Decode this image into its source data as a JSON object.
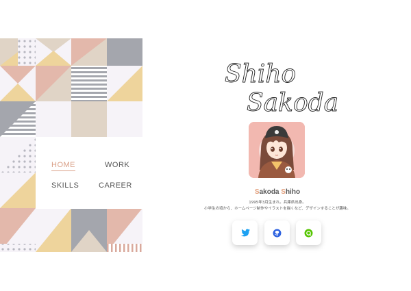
{
  "nav": {
    "items": [
      {
        "label": "HOME",
        "active": true
      },
      {
        "label": "WORK",
        "active": false
      },
      {
        "label": "SKILLS",
        "active": false
      },
      {
        "label": "CAREER",
        "active": false
      }
    ]
  },
  "profile": {
    "signature_line1": "Shiho",
    "signature_line2": "Sakoda",
    "name_initial_1": "S",
    "name_rest_1": "akoda ",
    "name_initial_2": "S",
    "name_rest_2": "hiho",
    "bio_line1": "1995年3月生まれ。兵庫県出身。",
    "bio_line2": "小学生の頃から、ホームページ制作やイラストを描くなど、デザインすることが趣味。"
  },
  "social": [
    {
      "name": "twitter-icon",
      "color": "#1da1f2"
    },
    {
      "name": "github-icon",
      "color": "#2f63e0"
    },
    {
      "name": "qiita-icon",
      "color": "#55c500"
    }
  ],
  "colors": {
    "accent": "#d99f86",
    "pink": "#e3b8ab",
    "beige": "#e0d4c6",
    "gray": "#a4a6ad",
    "yellow": "#eed49c",
    "lavender": "#f6f3f8"
  }
}
